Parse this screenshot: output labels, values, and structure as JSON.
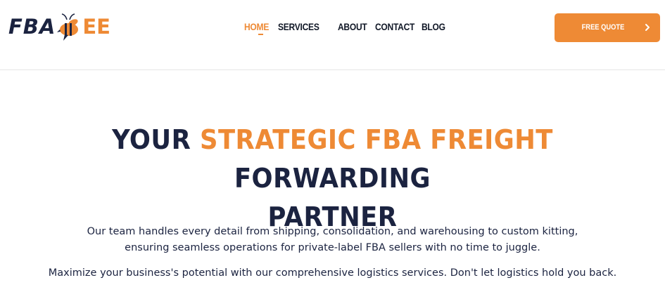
{
  "brand": {
    "logo_part1": "FBA",
    "logo_part2": "EE",
    "colors": {
      "navy": "#1b2340",
      "orange": "#ee8a35",
      "white": "#ffffff"
    }
  },
  "nav": {
    "items": [
      {
        "label": "HOME",
        "active": true
      },
      {
        "label": "SERVICES",
        "active": false
      },
      {
        "label": "ABOUT",
        "active": false
      },
      {
        "label": "CONTACT",
        "active": false
      },
      {
        "label": "BLOG",
        "active": false
      }
    ]
  },
  "cta": {
    "label": "FREE QUOTE",
    "icon": "chevron-right-icon"
  },
  "hero": {
    "title_part1": "YOUR ",
    "title_highlight": "STRATEGIC FBA FREIGHT",
    "title_part2": " FORWARDING",
    "title_line2": "PARTNER",
    "description": "Our team handles every detail from shipping, consolidation, and warehousing to custom kitting, ensuring seamless operations for private-label FBA sellers with no time to juggle.",
    "description2": "Maximize your business's potential with our comprehensive logistics services. Don't let logistics hold you back."
  }
}
